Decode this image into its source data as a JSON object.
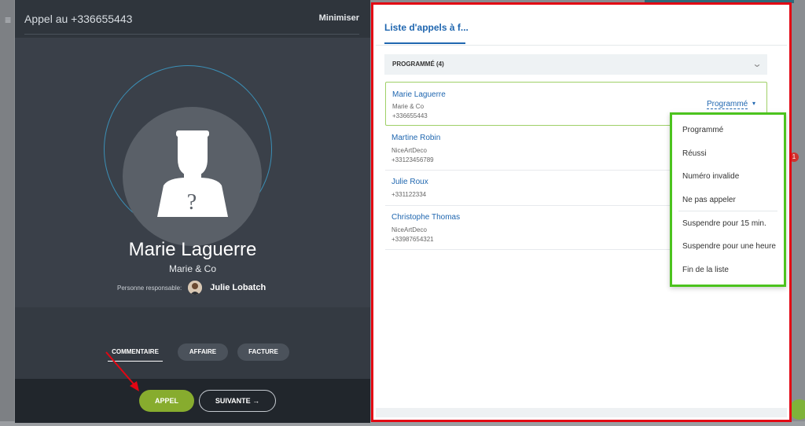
{
  "call": {
    "title": "Appel au +336655443",
    "minimize": "Minimiser",
    "contact": {
      "name": "Marie Laguerre",
      "company": "Marie & Co",
      "responsible_label": "Personne responsable:",
      "responsible_name": "Julie Lobatch"
    },
    "tabs": [
      "COMMENTAIRE",
      "AFFAIRE",
      "FACTURE"
    ],
    "actions": {
      "call": "APPEL",
      "next": "SUIVANTE →"
    }
  },
  "list": {
    "tab": "Liste d'appels à f...",
    "group": "PROGRAMMÉ (4)",
    "items": [
      {
        "name": "Marie Laguerre",
        "company": "Marie & Co",
        "phone": "+336655443",
        "status": "Programmé"
      },
      {
        "name": "Martine Robin",
        "company": "NiceArtDeco",
        "phone": "+33123456789"
      },
      {
        "name": "Julie Roux",
        "company": "",
        "phone": "+331122334"
      },
      {
        "name": "Christophe Thomas",
        "company": "NiceArtDeco",
        "phone": "+33987654321"
      }
    ]
  },
  "status_menu": [
    "Programmé",
    "Réussi",
    "Numéro invalide",
    "Ne pas appeler",
    "Suspendre pour 15 min.",
    "Suspendre pour une heure",
    "Fin de la liste"
  ],
  "icons": {
    "menu": "hamburger-icon",
    "chevron": "chevron-down-icon",
    "caret": "caret-down-icon",
    "arrow": "arrow-right-icon"
  },
  "colors": {
    "accent_blue": "#2067b0",
    "highlight_red": "#e30613",
    "highlight_green": "#4cc31e",
    "call_green": "#87ac2e"
  }
}
